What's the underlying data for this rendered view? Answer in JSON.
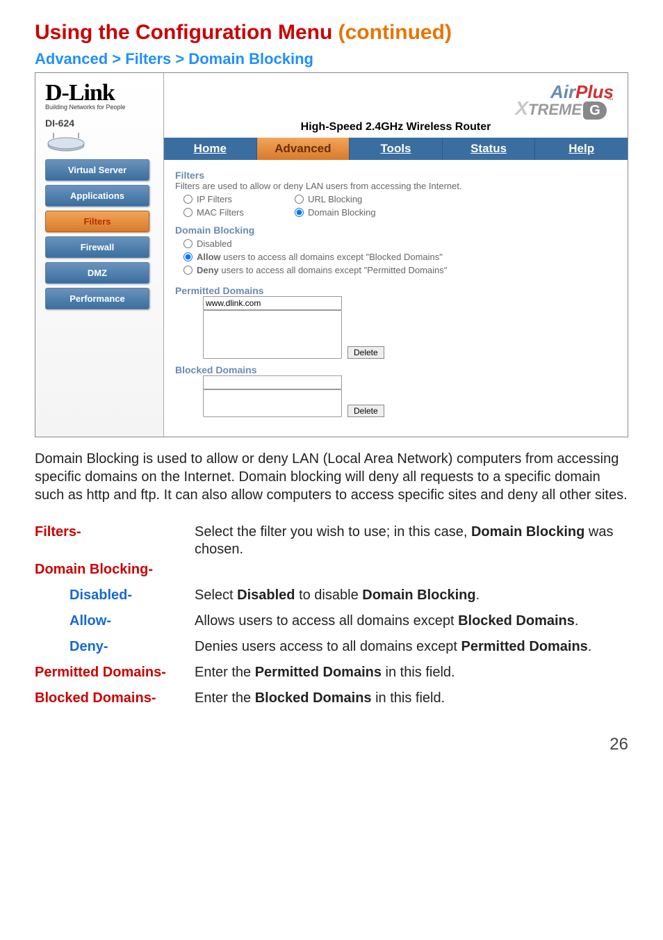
{
  "page_title_main": "Using the Configuration Menu",
  "page_title_cont": " (continued)",
  "breadcrumb": "Advanced > Filters > Domain Blocking",
  "logo": "D-Link",
  "logo_sub": "Building Networks for People",
  "model": "DI-624",
  "nav": {
    "virtual_server": "Virtual Server",
    "applications": "Applications",
    "filters": "Filters",
    "firewall": "Firewall",
    "dmz": "DMZ",
    "performance": "Performance"
  },
  "product": {
    "air": "Air",
    "plus": "Plus",
    "xtreme": "TREME",
    "g": "G",
    "tm": "™"
  },
  "tagline": "High-Speed 2.4GHz Wireless Router",
  "tabs": {
    "home": "Home",
    "advanced": "Advanced",
    "tools": "Tools",
    "status": "Status",
    "help": "Help"
  },
  "panel": {
    "filters_head": "Filters",
    "filters_desc": "Filters are used to allow or deny LAN users from accessing the Internet.",
    "ip_filters": "IP Filters",
    "url_blocking": "URL Blocking",
    "mac_filters": "MAC Filters",
    "domain_blocking": "Domain Blocking",
    "db_head": "Domain Blocking",
    "disabled": "Disabled",
    "allow_pre": "Allow",
    "allow_post": " users to access all domains except \"Blocked Domains\"",
    "deny_pre": "Deny",
    "deny_post": " users to access all domains except \"Permitted Domains\"",
    "permitted_head": "Permitted Domains",
    "permitted_value": "www.dlink.com",
    "blocked_head": "Blocked Domains",
    "blocked_value": "",
    "delete": "Delete"
  },
  "desc_para": "Domain Blocking is used to allow or deny LAN (Local Area Network) computers from accessing specific domains on the Internet. Domain blocking will deny all requests to a specific domain such as http and ftp. It can also allow computers to access specific sites and deny all other sites.",
  "defs": {
    "filters_term": "Filters-",
    "filters_text_a": "Select the filter you wish to use; in this case, ",
    "filters_text_b": "Domain Blocking",
    "filters_text_c": " was chosen.",
    "db_term": "Domain Blocking-",
    "disabled_term": "Disabled-",
    "disabled_text_a": "Select ",
    "disabled_text_b": "Disabled",
    "disabled_text_c": " to disable ",
    "disabled_text_d": "Domain Blocking",
    "disabled_text_e": ".",
    "allow_term": "Allow-",
    "allow_text_a": "Allows users to access all domains except ",
    "allow_text_b": "Blocked Domains",
    "allow_text_c": ".",
    "deny_term": "Deny-",
    "deny_text_a": "Denies users  access to  all domains except ",
    "deny_text_b": "Permitted Domains",
    "deny_text_c": ".",
    "permitted_term": "Permitted Domains-",
    "permitted_text_a": "Enter the ",
    "permitted_text_b": "Permitted Domains",
    "permitted_text_c": " in this field.",
    "blocked_term": "Blocked Domains-",
    "blocked_text_a": "Enter the ",
    "blocked_text_b": "Blocked Domains",
    "blocked_text_c": " in this field."
  },
  "page_number": "26"
}
